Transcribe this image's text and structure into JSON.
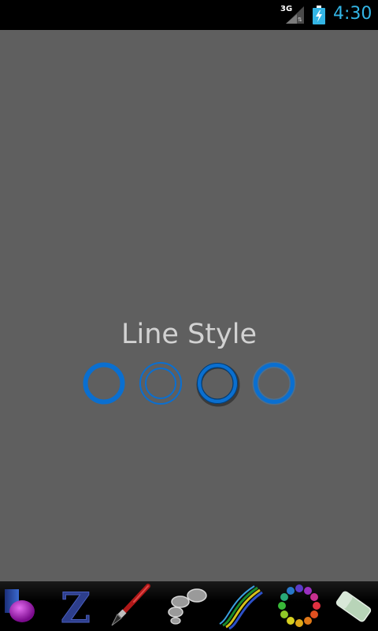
{
  "status_bar": {
    "network": "3G",
    "time": "4:30",
    "time_color": "#33b5e5"
  },
  "dialog": {
    "title": "Line Style",
    "accent_color": "#0a6fd0",
    "options": [
      {
        "name": "solid-ring",
        "icon": "line-style-solid-icon"
      },
      {
        "name": "double-ring",
        "icon": "line-style-double-icon"
      },
      {
        "name": "embossed-ring",
        "icon": "line-style-embossed-icon"
      },
      {
        "name": "glow-ring",
        "icon": "line-style-glow-icon"
      }
    ]
  },
  "toolbar": {
    "tools": [
      {
        "icon": "paint-bucket-icon"
      },
      {
        "icon": "text-icon"
      },
      {
        "icon": "brush-icon"
      },
      {
        "icon": "stamp-icon"
      },
      {
        "icon": "rainbow-brush-icon"
      },
      {
        "icon": "color-palette-icon"
      },
      {
        "icon": "eraser-icon"
      }
    ]
  },
  "colors": {
    "canvas_background": "#5f5f5f",
    "toolbar_background": "#000000"
  }
}
